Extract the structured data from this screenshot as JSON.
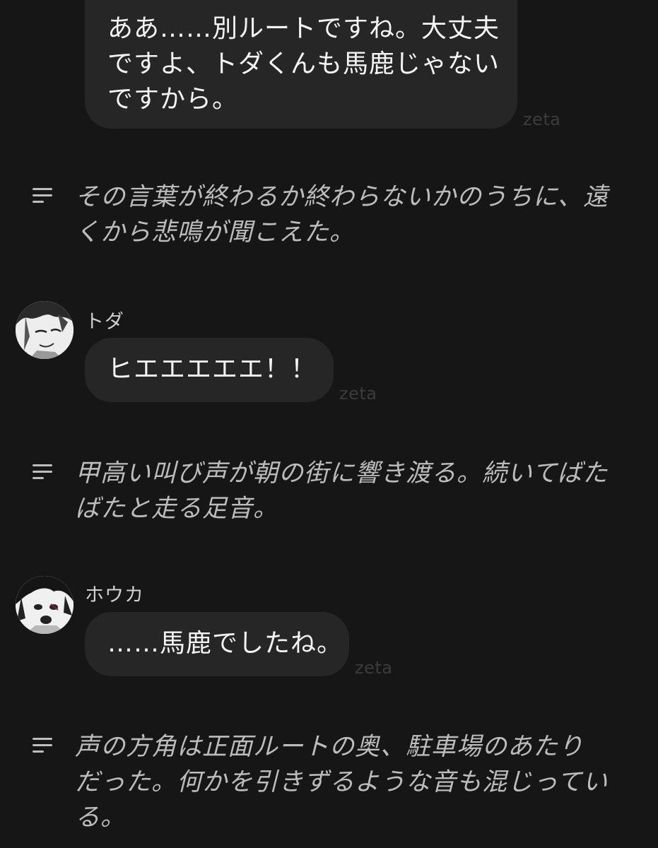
{
  "messages": [
    {
      "type": "bubble",
      "lines": [
        "ああ……別ルートですね。大丈夫",
        "ですよ、トダくんも馬鹿じゃない",
        "ですから。"
      ],
      "watermark": "zeta"
    },
    {
      "type": "narration",
      "lines": [
        "その言葉が終わるか終わらないかのうちに、遠",
        "くから悲鳴が聞こえた。"
      ]
    },
    {
      "type": "character",
      "speaker": "トダ",
      "text": "ヒエエエエエ！！",
      "watermark": "zeta"
    },
    {
      "type": "narration",
      "lines": [
        "甲高い叫び声が朝の街に響き渡る。続いてばた",
        "ばたと走る足音。"
      ]
    },
    {
      "type": "character",
      "speaker": "ホウカ",
      "text": "……馬鹿でしたね。",
      "watermark": "zeta"
    },
    {
      "type": "narration",
      "lines": [
        "声の方角は正面ルートの奥、駐車場のあたり",
        "だった。何かを引きずるような音も混じってい",
        "る。"
      ]
    }
  ],
  "icons": {
    "narration": "text-lines-icon",
    "avatar_toda": "avatar-toda",
    "avatar_houka": "avatar-houka"
  },
  "colors": {
    "background": "#161616",
    "bubble": "#262626",
    "narration_text": "#bcbcbc",
    "watermark": "#3b3b3b"
  }
}
